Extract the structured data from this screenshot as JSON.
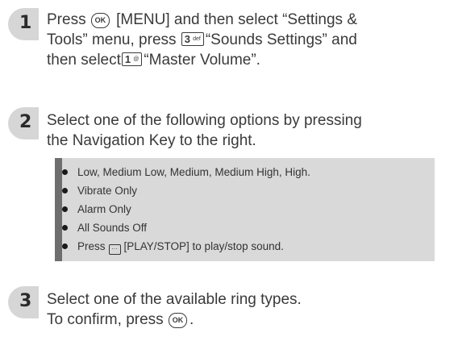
{
  "steps": [
    {
      "number": "1",
      "parts": {
        "a": "Press",
        "key_ok": "OK",
        "b": "[MENU] and then select “Settings &",
        "c": "Tools” menu, press",
        "key_3_main": "3",
        "key_3_sub": "def",
        "d": "“Sounds Settings” and",
        "e": "then select",
        "key_1_main": "1",
        "key_1_sub": "@",
        "f": "“Master Volume”."
      }
    },
    {
      "number": "2",
      "line1": "Select one of the following options by pressing",
      "line2": "the Navigation Key to the right."
    },
    {
      "number": "3",
      "line1": "Select one of the available ring types.",
      "line2_a": "To confirm, press",
      "key_ok": "OK",
      "line2_b": "."
    }
  ],
  "options": {
    "items": [
      "Low, Medium Low, Medium, Medium High, High.",
      "Vibrate Only",
      "Alarm Only",
      "All Sounds Off"
    ],
    "last_item_a": "Press",
    "last_item_key": "···",
    "last_item_b": "[PLAY/STOP] to play/stop sound."
  }
}
